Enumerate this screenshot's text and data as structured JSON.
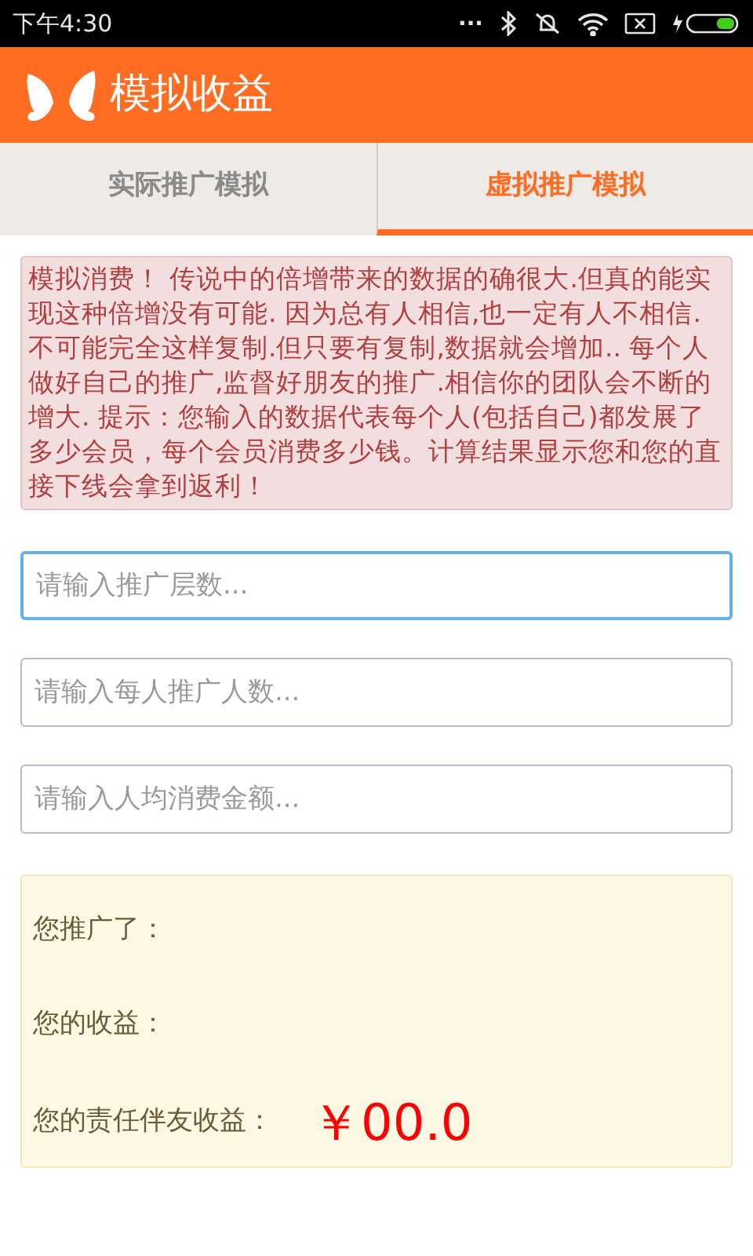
{
  "status_bar": {
    "time": "下午4:30",
    "dots": "..."
  },
  "app_bar": {
    "title": "模拟收益"
  },
  "tabs": [
    {
      "label": "实际推广模拟",
      "selected": false
    },
    {
      "label": "虚拟推广模拟",
      "selected": true
    }
  ],
  "notice": "模拟消费！ 传说中的倍增带来的数据的确很大.但真的能实现这种倍增没有可能. 因为总有人相信,也一定有人不相信.不可能完全这样复制.但只要有复制,数据就会增加.. 每个人做好自己的推广,监督好朋友的推广.相信你的团队会不断的增大. 提示：您输入的数据代表每个人(包括自己)都发展了多少会员，每个会员消费多少钱。计算结果显示您和您的直接下线会拿到返利！",
  "fields": [
    {
      "placeholder": "请输入推广层数...",
      "focused": true
    },
    {
      "placeholder": "请输入每人推广人数...",
      "focused": false
    },
    {
      "placeholder": "请输入人均消费金额...",
      "focused": false
    }
  ],
  "results": [
    {
      "label": "您推广了："
    },
    {
      "label": "您的收益："
    },
    {
      "label": "您的责任伴友收益：",
      "amount": "￥00.0"
    }
  ]
}
